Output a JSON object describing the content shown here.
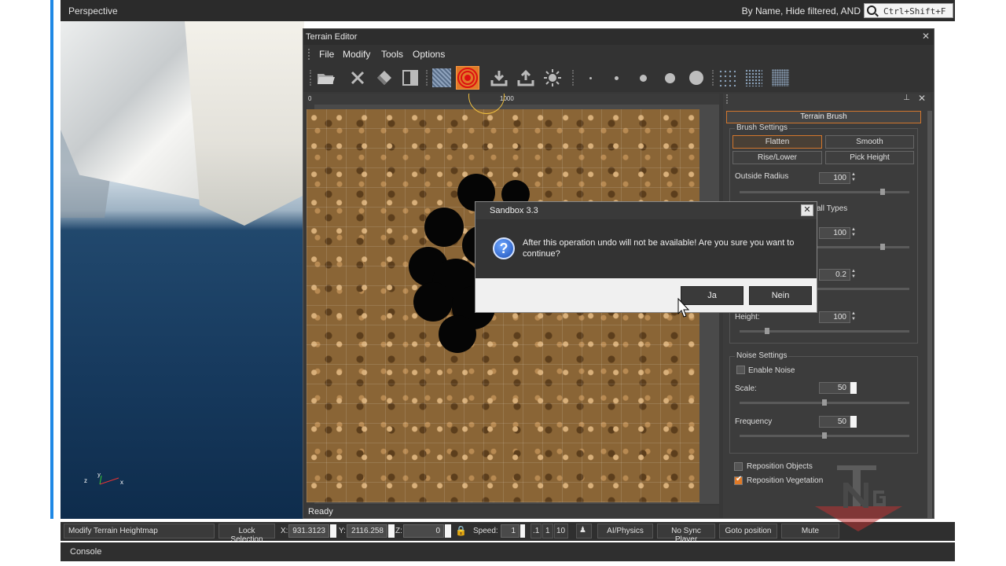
{
  "viewport": {
    "title": "Perspective",
    "filter_label": "By Name, Hide filtered, AND",
    "search_shortcut": "Ctrl+Shift+F"
  },
  "terrain_editor": {
    "title": "Terrain Editor",
    "menu": [
      "File",
      "Modify",
      "Tools",
      "Options"
    ],
    "toolbar_icons": [
      "open-folder-icon",
      "delete-icon",
      "eraser-icon",
      "half-square-icon",
      "water-texture-icon",
      "terrain-brush-icon",
      "import-icon",
      "export-icon",
      "sun-icon",
      "brush-size-1-icon",
      "brush-size-2-icon",
      "brush-size-3-icon",
      "brush-size-4-icon",
      "brush-size-5-icon",
      "grid-small-icon",
      "grid-medium-icon",
      "grid-large-icon"
    ],
    "ruler": {
      "top_start": "0",
      "top_mid": "1000",
      "left_mid": "1000"
    },
    "status": "Ready"
  },
  "panel": {
    "title": "Terrain Brush",
    "brush_settings": {
      "title": "Brush Settings",
      "buttons": [
        "Flatten",
        "Smooth",
        "Rise/Lower",
        "Pick Height"
      ],
      "active": "Flatten",
      "outside_radius_label": "Outside Radius",
      "outside_radius_value": "100",
      "partial_label": "all Types",
      "inside_radius_value": "100",
      "hardness_value": "0.2",
      "height_label": "Height:",
      "height_value": "100",
      "outside_radius_slider": 0.85,
      "inside_radius_slider": 0.85,
      "height_slider": 0.15
    },
    "noise_settings": {
      "title": "Noise Settings",
      "enable_noise_label": "Enable Noise",
      "enable_noise": false,
      "scale_label": "Scale:",
      "scale_value": "50",
      "frequency_label": "Frequency",
      "frequency_value": "50",
      "scale_slider": 0.5,
      "frequency_slider": 0.5
    },
    "reposition_objects_label": "Reposition Objects",
    "reposition_objects": false,
    "reposition_vegetation_label": "Reposition Vegetation",
    "reposition_vegetation": true
  },
  "dialog": {
    "title": "Sandbox 3.3",
    "message": "After this operation undo will not be available! Are you sure you want to continue?",
    "yes_label": "Ja",
    "no_label": "Nein"
  },
  "bottom_bar": {
    "mode": "Modify Terrain Heightmap",
    "lock_selection": "Lock Selection",
    "x_label": "X:",
    "x_value": "931.3123",
    "y_label": "Y:",
    "y_value": "2116.258",
    "z_label": "Z:",
    "z_value": "0",
    "speed_label": "Speed:",
    "speed_value": "1",
    "speed_presets": [
      ".1",
      "1",
      "10"
    ],
    "ai_physics": "AI/Physics",
    "no_sync_player": "No Sync Player",
    "goto_position": "Goto position",
    "mute": "Mute"
  },
  "console": {
    "title": "Console"
  },
  "colors": {
    "accent_orange": "#e07a28",
    "window_bg": "#383838",
    "dialog_icon_blue": "#1c4fb8"
  }
}
